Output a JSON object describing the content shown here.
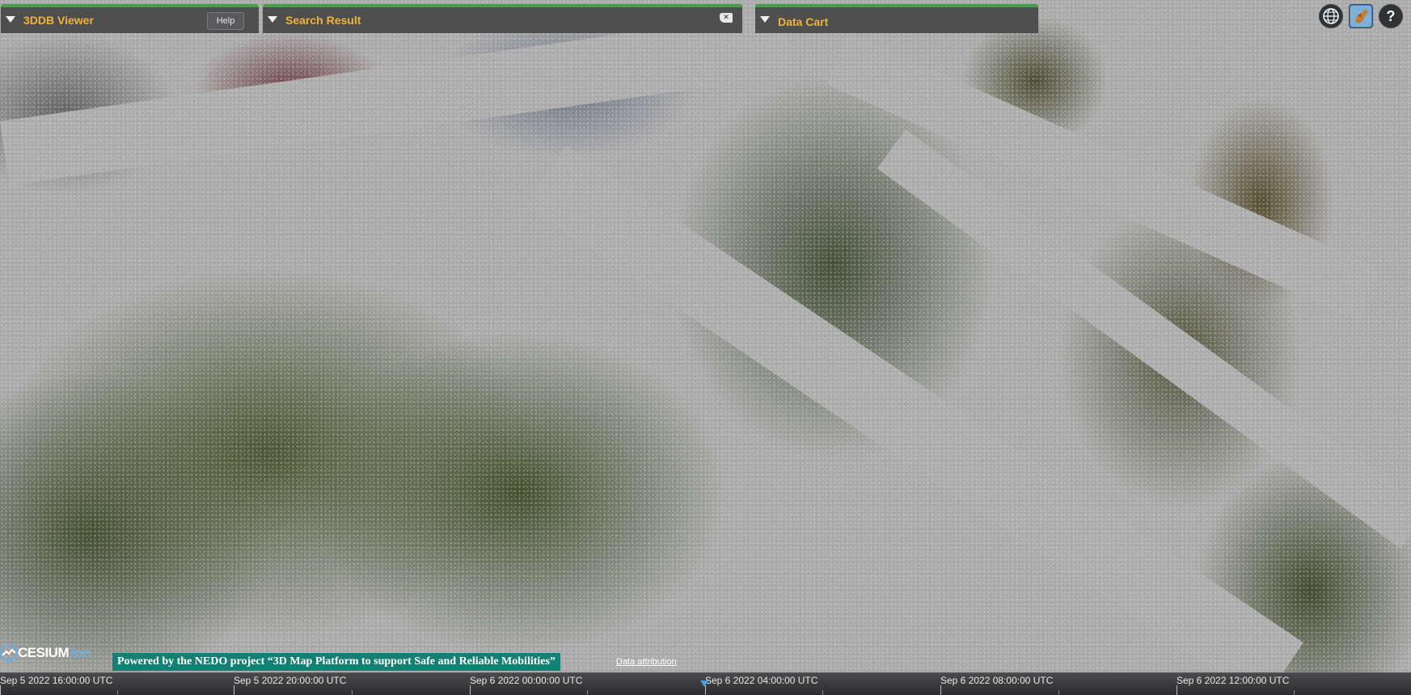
{
  "panels": {
    "viewer": {
      "title": "3DDB Viewer",
      "help_label": "Help"
    },
    "search": {
      "title": "Search Result",
      "clear_icon": "clear-icon"
    },
    "cart": {
      "title": "Data Cart"
    }
  },
  "toolbar": {
    "icons": [
      "globe-icon",
      "base-layer-picker-icon",
      "help-icon"
    ],
    "help_glyph": "?"
  },
  "credits": {
    "logo_word": "CESIUM",
    "logo_suffix": "ion",
    "banner": "Powered by the NEDO project “3D Map Platform to support Safe and Reliable Mobilities”",
    "attribution": "Data attribution"
  },
  "timeline": {
    "labels": [
      "Sep 5 2022 16:00:00 UTC",
      "Sep 5 2022 20:00:00 UTC",
      "Sep 6 2022 00:00:00 UTC",
      "Sep 6 2022 04:00:00 UTC",
      "Sep 6 2022 08:00:00 UTC",
      "Sep 6 2022 12:00:00 UTC"
    ]
  },
  "colors": {
    "panel_accent": "#43a047",
    "panel_title": "#f0b33a",
    "banner_bg": "#148073",
    "needle": "#4aa0e6"
  }
}
